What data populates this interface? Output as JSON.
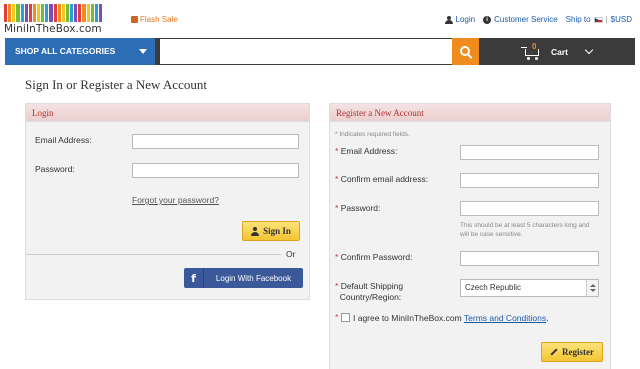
{
  "header": {
    "logo_text": "MiniInTheBox.com",
    "logo_stripe_colors": [
      "#e23c3c",
      "#f08c1e",
      "#f7c51e",
      "#6fbf3b",
      "#2d9fd6",
      "#7a4fb8",
      "#e23c3c",
      "#f08c1e",
      "#f7c51e",
      "#6fbf3b",
      "#2d9fd6",
      "#7a4fb8",
      "#e23c3c",
      "#f08c1e",
      "#f7c51e",
      "#6fbf3b",
      "#2d9fd6",
      "#7a4fb8",
      "#e23c3c",
      "#f08c1e",
      "#f7c51e",
      "#6fbf3b",
      "#2d9fd6",
      "#7a4fb8"
    ],
    "flash_sale": "Flash Sale",
    "login_link": "Login",
    "customer_service": "Customer Service",
    "ship_to": "Ship to",
    "currency": "$USD"
  },
  "nav": {
    "shop_all": "SHOP ALL CATEGORIES",
    "search_value": "",
    "cart_count": "0",
    "cart_label": "Cart"
  },
  "page_title": "Sign In or Register a New Account",
  "login": {
    "heading": "Login",
    "email_label": "Email Address:",
    "password_label": "Password:",
    "forgot": "Forgot your password?",
    "sign_in": "Sign In",
    "or": "Or",
    "facebook": "Login With Facebook",
    "facebook_icon": "f"
  },
  "register": {
    "heading": "Register a New Account",
    "required_note": "* Indicates required fields.",
    "email_label": "Email Address:",
    "confirm_email_label": "Confirm email address:",
    "password_label": "Password:",
    "password_hint": "This should be at least 5 characters long and will be case sensitive.",
    "confirm_password_label": "Confirm Password:",
    "country_label_1": "Default Shipping",
    "country_label_2": "Country/Region:",
    "country_value": "Czech Republic",
    "agree_text": "I agree to MiniInTheBox.com",
    "terms": "Terms and Conditions",
    "terms_suffix": ".",
    "register_button": "Register"
  },
  "colors": {
    "accent_blue": "#2d6db5",
    "search_orange": "#f08c1e",
    "facebook_blue": "#3b5998",
    "button_yellow": "#f5c532",
    "heading_red": "#b03030"
  }
}
